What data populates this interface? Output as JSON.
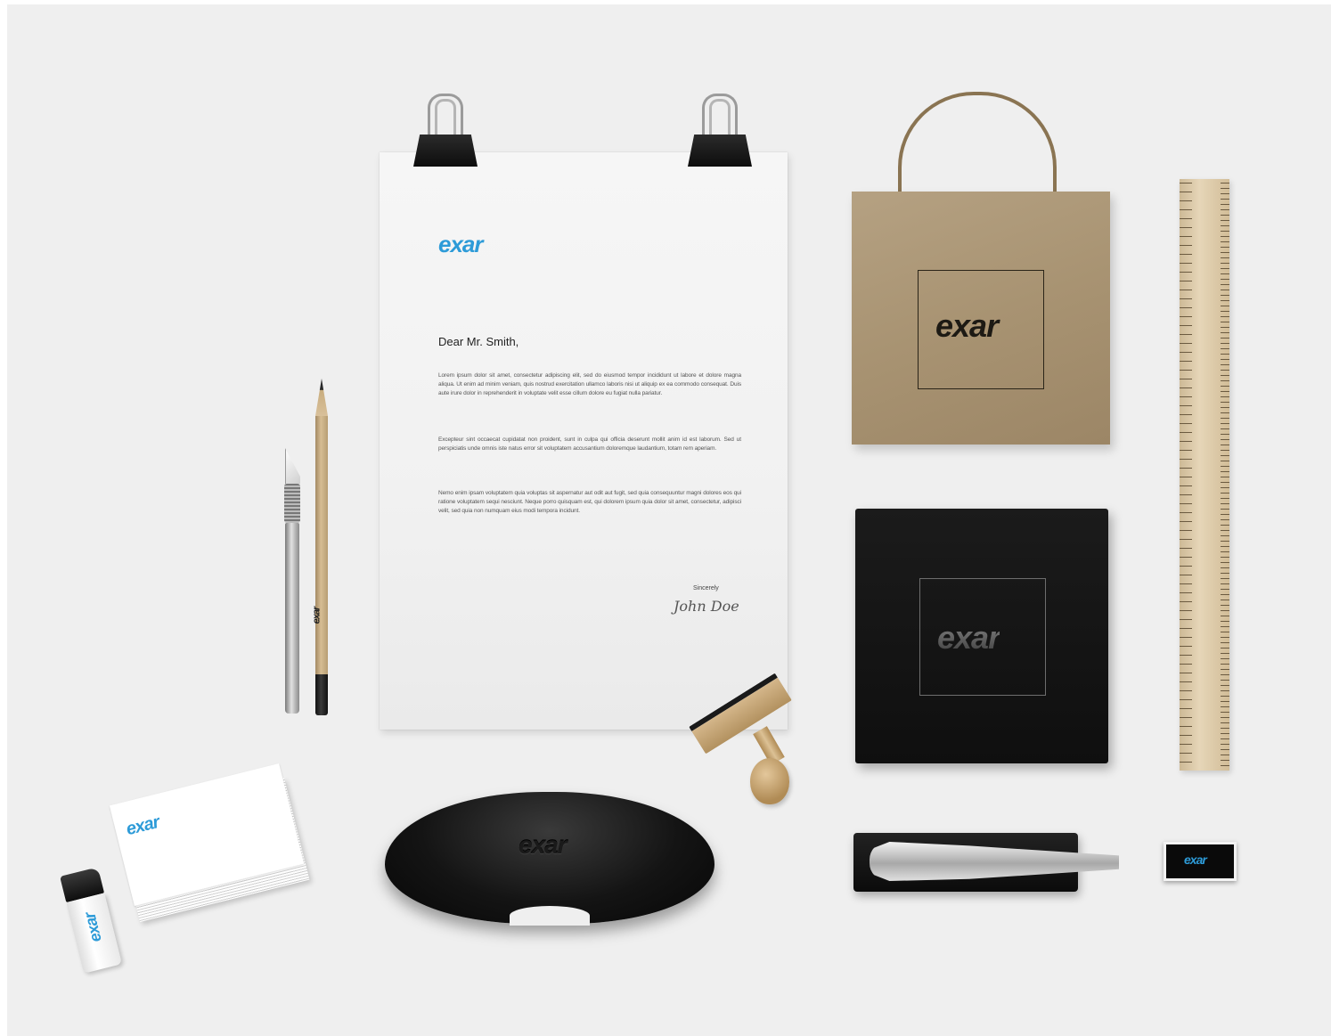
{
  "brand": {
    "name": "exar",
    "accent_color": "#2d9bd8"
  },
  "letterhead": {
    "logo": "exar",
    "greeting": "Dear Mr. Smith,",
    "paragraph_1": "Lorem ipsum dolor sit amet, consectetur adipiscing elit, sed do eiusmod tempor incididunt ut labore et dolore magna aliqua. Ut enim ad minim veniam, quis nostrud exercitation ullamco laboris nisi ut aliquip ex ea commodo consequat. Duis aute irure dolor in reprehenderit in voluptate velit esse cillum dolore eu fugiat nulla pariatur.",
    "paragraph_2": "Excepteur sint occaecat cupidatat non proident, sunt in culpa qui officia deserunt mollit anim id est laborum. Sed ut perspiciatis unde omnis iste natus error sit voluptatem accusantium doloremque laudantium, totam rem aperiam.",
    "paragraph_3": "Nemo enim ipsam voluptatem quia voluptas sit aspernatur aut odit aut fugit, sed quia consequuntur magni dolores eos qui ratione voluptatem sequi nesciunt. Neque porro quisquam est, qui dolorem ipsum quia dolor sit amet, consectetur, adipisci velit, sed quia non numquam eius modi tempora incidunt.",
    "closing": "Sincerely",
    "signature": "John Doe"
  },
  "bag": {
    "logo": "exar"
  },
  "box": {
    "logo": "exar"
  },
  "glasses_case": {
    "logo": "exar"
  },
  "usb": {
    "logo": "exar"
  },
  "business_card": {
    "logo": "exar",
    "job": "",
    "contact_lines": [
      "",
      "",
      ""
    ],
    "address_lines": [
      "",
      "",
      ""
    ]
  },
  "lighter": {
    "logo": "exar"
  },
  "pencil": {
    "brand": "exar"
  }
}
